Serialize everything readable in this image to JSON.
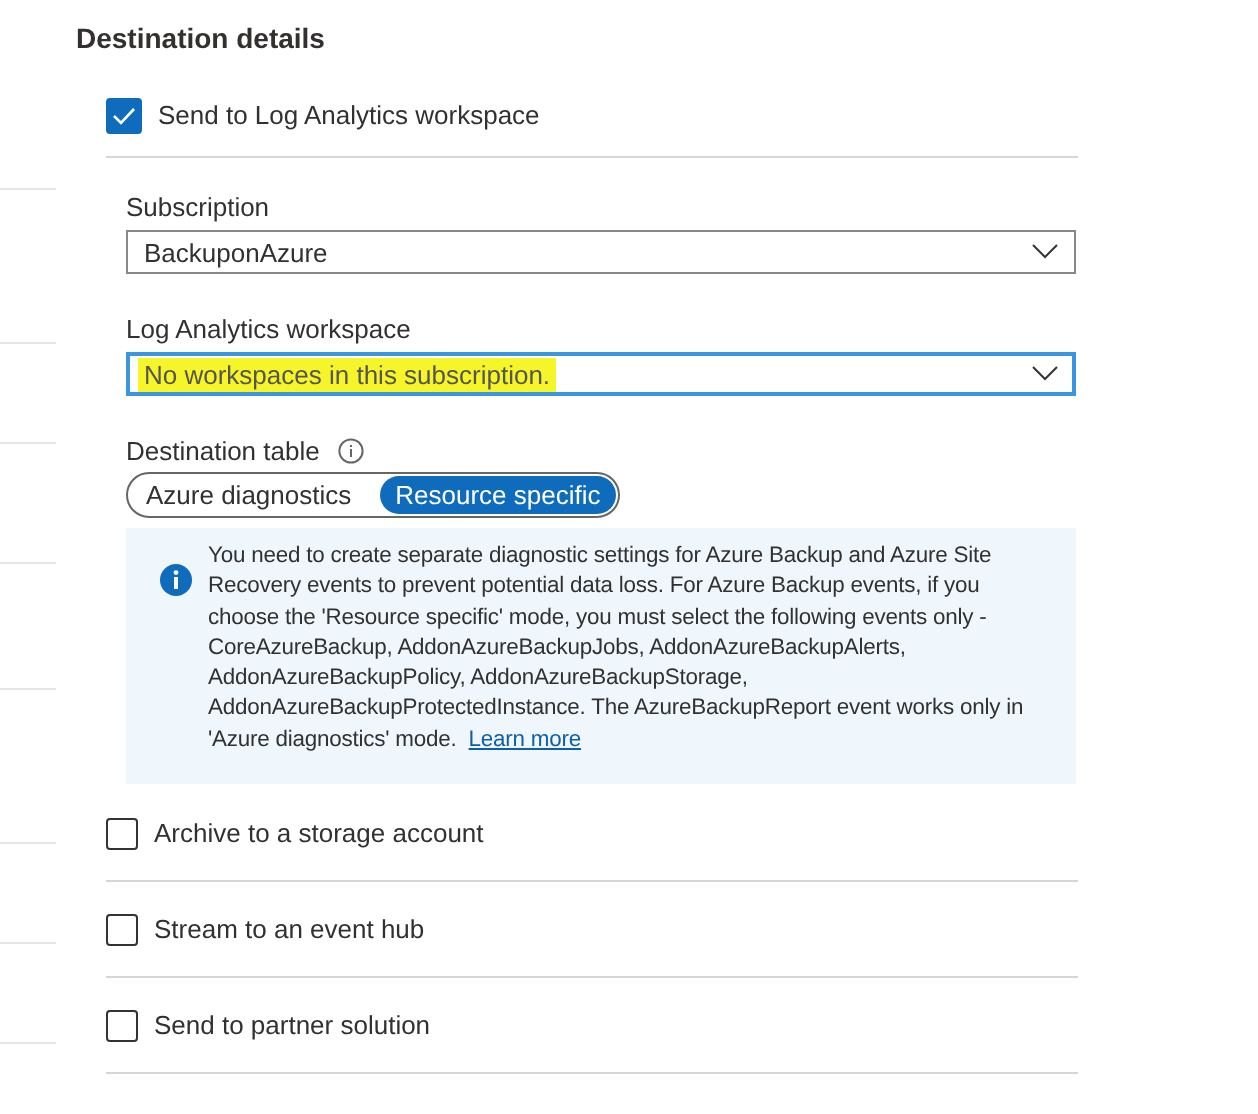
{
  "heading": "Destination details",
  "log_analytics": {
    "label": "Send to Log Analytics workspace",
    "checked": true
  },
  "subscription": {
    "label": "Subscription",
    "value": "BackuponAzure"
  },
  "workspace": {
    "label": "Log Analytics workspace",
    "placeholder": "No workspaces in this subscription.",
    "highlighted": true,
    "focused": true
  },
  "destination_table": {
    "label": "Destination table",
    "options": [
      {
        "label": "Azure diagnostics",
        "selected": false
      },
      {
        "label": "Resource specific",
        "selected": true
      }
    ]
  },
  "info": {
    "text": "You need to create separate diagnostic settings for Azure Backup and Azure Site Recovery events to prevent potential data loss. For Azure Backup events, if you choose the 'Resource specific' mode, you must select the following events only - CoreAzureBackup, AddonAzureBackupJobs, AddonAzureBackupAlerts, AddonAzureBackupPolicy, AddonAzureBackupStorage, AddonAzureBackupProtectedInstance. The AzureBackupReport event works only in 'Azure diagnostics' mode.",
    "link": "Learn more"
  },
  "destinations": [
    {
      "label": "Archive to a storage account",
      "checked": false
    },
    {
      "label": "Stream to an event hub",
      "checked": false
    },
    {
      "label": "Send to partner solution",
      "checked": false
    }
  ]
}
